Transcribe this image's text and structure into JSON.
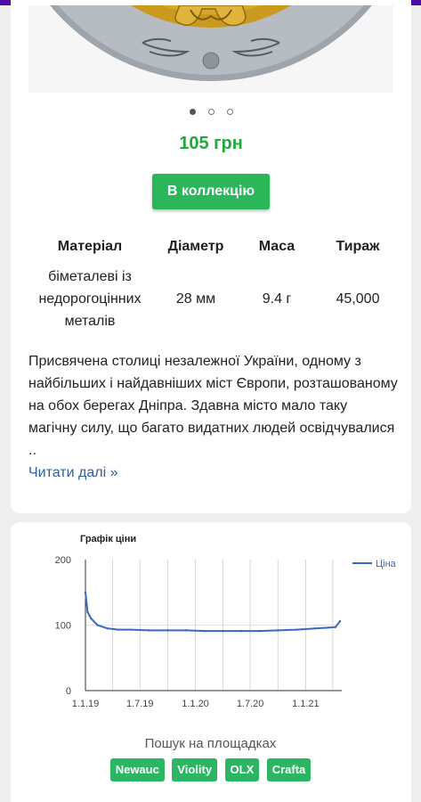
{
  "product": {
    "price": "105 грн",
    "collect_label": "В коллекцію"
  },
  "carousel": {
    "slide_count": 3,
    "active_index": 0
  },
  "specs": {
    "headers": [
      "Матеріал",
      "Діаметр",
      "Маса",
      "Тираж"
    ],
    "material_lines": [
      "біметалеві із",
      "недорогоцінних",
      "металів"
    ],
    "diameter": "28 мм",
    "mass": "9.4 г",
    "mintage": "45,000"
  },
  "description": {
    "text": "Присвячена столиці незалежної України, одному з найбільших і найдавніших міст Європи, розташованому на обох берегах Дніпра. Здавна місто мало таку магічну силу, що багато видатних людей освідчувалися ..",
    "read_more": "Читати далі »"
  },
  "chart_data": {
    "type": "line",
    "title": "Графік ціни",
    "ylim": [
      0,
      200
    ],
    "yticks": [
      "0",
      "100",
      "200"
    ],
    "xticks": [
      "1.1.19",
      "1.7.19",
      "1.1.20",
      "1.7.20",
      "1.1.21"
    ],
    "legend_position": "top-right",
    "grid": true,
    "series": [
      {
        "name": "Ціна",
        "color": "#3a68c2",
        "x": [
          "2019-01-01",
          "2019-01-08",
          "2019-01-20",
          "2019-02-10",
          "2019-03-15",
          "2019-04-20",
          "2019-06-01",
          "2019-08-01",
          "2019-10-01",
          "2019-12-01",
          "2020-02-01",
          "2020-04-01",
          "2020-06-01",
          "2020-08-01",
          "2020-10-01",
          "2020-12-01",
          "2021-02-01",
          "2021-03-15",
          "2021-04-10",
          "2021-04-25"
        ],
        "y": [
          150,
          120,
          110,
          100,
          95,
          93,
          93,
          92,
          92,
          92,
          91,
          91,
          91,
          91,
          92,
          93,
          95,
          96,
          97,
          106
        ]
      }
    ]
  },
  "marketplaces": {
    "label": "Пошук на площадках",
    "items": [
      "Newauc",
      "Violity",
      "OLX",
      "Crafta"
    ]
  }
}
